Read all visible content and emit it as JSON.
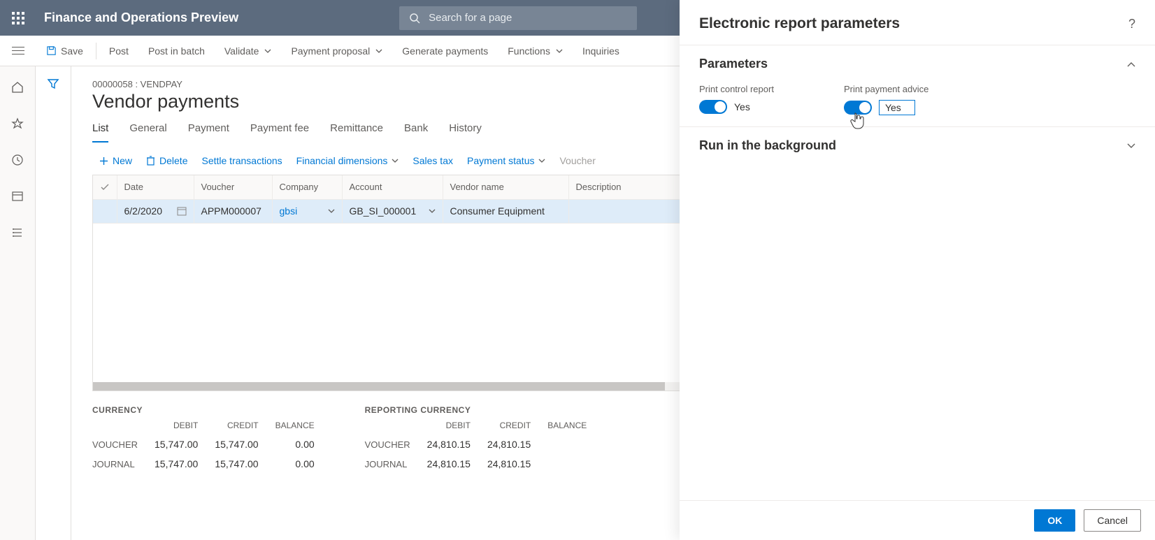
{
  "app": {
    "title": "Finance and Operations Preview",
    "search_placeholder": "Search for a page"
  },
  "commands": {
    "save": "Save",
    "post": "Post",
    "post_in_batch": "Post in batch",
    "validate": "Validate",
    "payment_proposal": "Payment proposal",
    "generate_payments": "Generate payments",
    "functions": "Functions",
    "inquiries": "Inquiries"
  },
  "page": {
    "breadcrumb": "00000058 : VENDPAY",
    "title": "Vendor payments"
  },
  "tabs": [
    "List",
    "General",
    "Payment",
    "Payment fee",
    "Remittance",
    "Bank",
    "History"
  ],
  "tabs_active_index": 0,
  "toolbar2": {
    "new": "New",
    "delete": "Delete",
    "settle": "Settle transactions",
    "fin_dim": "Financial dimensions",
    "sales_tax": "Sales tax",
    "pay_status": "Payment status",
    "voucher": "Voucher"
  },
  "grid": {
    "columns": [
      "Date",
      "Voucher",
      "Company",
      "Account",
      "Vendor name",
      "Description"
    ],
    "rows": [
      {
        "date": "6/2/2020",
        "voucher": "APPM000007",
        "company": "gbsi",
        "account": "GB_SI_000001",
        "vendor_name": "Consumer Equipment",
        "description": ""
      }
    ]
  },
  "totals": {
    "currency_label": "CURRENCY",
    "reporting_label": "REPORTING CURRENCY",
    "col_labels": {
      "debit": "DEBIT",
      "credit": "CREDIT",
      "balance": "BALANCE"
    },
    "row_labels": {
      "voucher": "VOUCHER",
      "journal": "JOURNAL"
    },
    "currency": {
      "voucher": {
        "debit": "15,747.00",
        "credit": "15,747.00",
        "balance": "0.00"
      },
      "journal": {
        "debit": "15,747.00",
        "credit": "15,747.00",
        "balance": "0.00"
      }
    },
    "reporting": {
      "voucher": {
        "debit": "24,810.15",
        "credit": "24,810.15",
        "balance": ""
      },
      "journal": {
        "debit": "24,810.15",
        "credit": "24,810.15",
        "balance": ""
      }
    }
  },
  "panel": {
    "title": "Electronic report parameters",
    "sections": {
      "parameters": {
        "label": "Parameters",
        "expanded": true
      },
      "background": {
        "label": "Run in the background",
        "expanded": false
      }
    },
    "options": {
      "print_control": {
        "label": "Print control report",
        "value": "Yes",
        "on": true
      },
      "print_advice": {
        "label": "Print payment advice",
        "value": "Yes",
        "on": true
      }
    },
    "buttons": {
      "ok": "OK",
      "cancel": "Cancel"
    }
  }
}
